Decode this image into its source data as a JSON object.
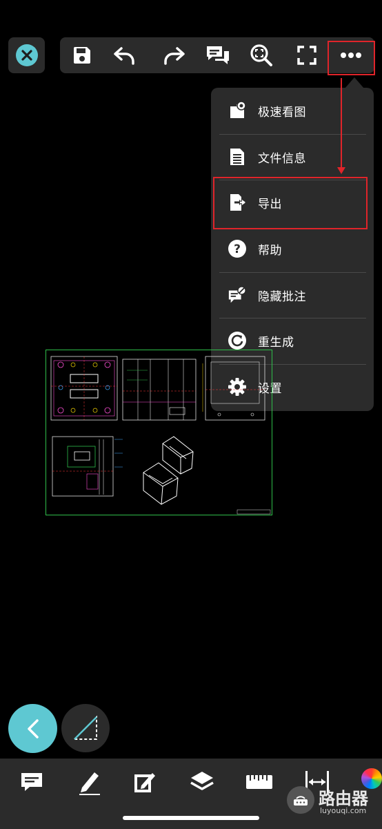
{
  "menu": {
    "items": [
      {
        "label": "极速看图",
        "icon": "quick-view-icon"
      },
      {
        "label": "文件信息",
        "icon": "file-info-icon"
      },
      {
        "label": "导出",
        "icon": "export-icon"
      },
      {
        "label": "帮助",
        "icon": "help-icon"
      },
      {
        "label": "隐藏批注",
        "icon": "hide-annotation-icon"
      },
      {
        "label": "重生成",
        "icon": "regenerate-icon"
      },
      {
        "label": "设置",
        "icon": "settings-icon"
      }
    ],
    "highlighted": "导出"
  },
  "toolbar": {
    "buttons": [
      "close-icon",
      "save-icon",
      "undo-icon",
      "redo-icon",
      "comments-icon",
      "zoom-fit-icon",
      "fullscreen-icon",
      "more-icon"
    ]
  },
  "bottom_toolbar": {
    "buttons": [
      "annotation-icon",
      "pen-icon",
      "edit-icon",
      "layers-icon",
      "ruler-icon",
      "dimension-icon",
      "color-wheel-icon"
    ]
  },
  "watermark": {
    "name": "路由器",
    "url": "luyouqi.com"
  },
  "colors": {
    "accent": "#5ec8d2",
    "panel": "#2b2b2b",
    "highlight": "#e0242a",
    "canvas": "#000000"
  }
}
